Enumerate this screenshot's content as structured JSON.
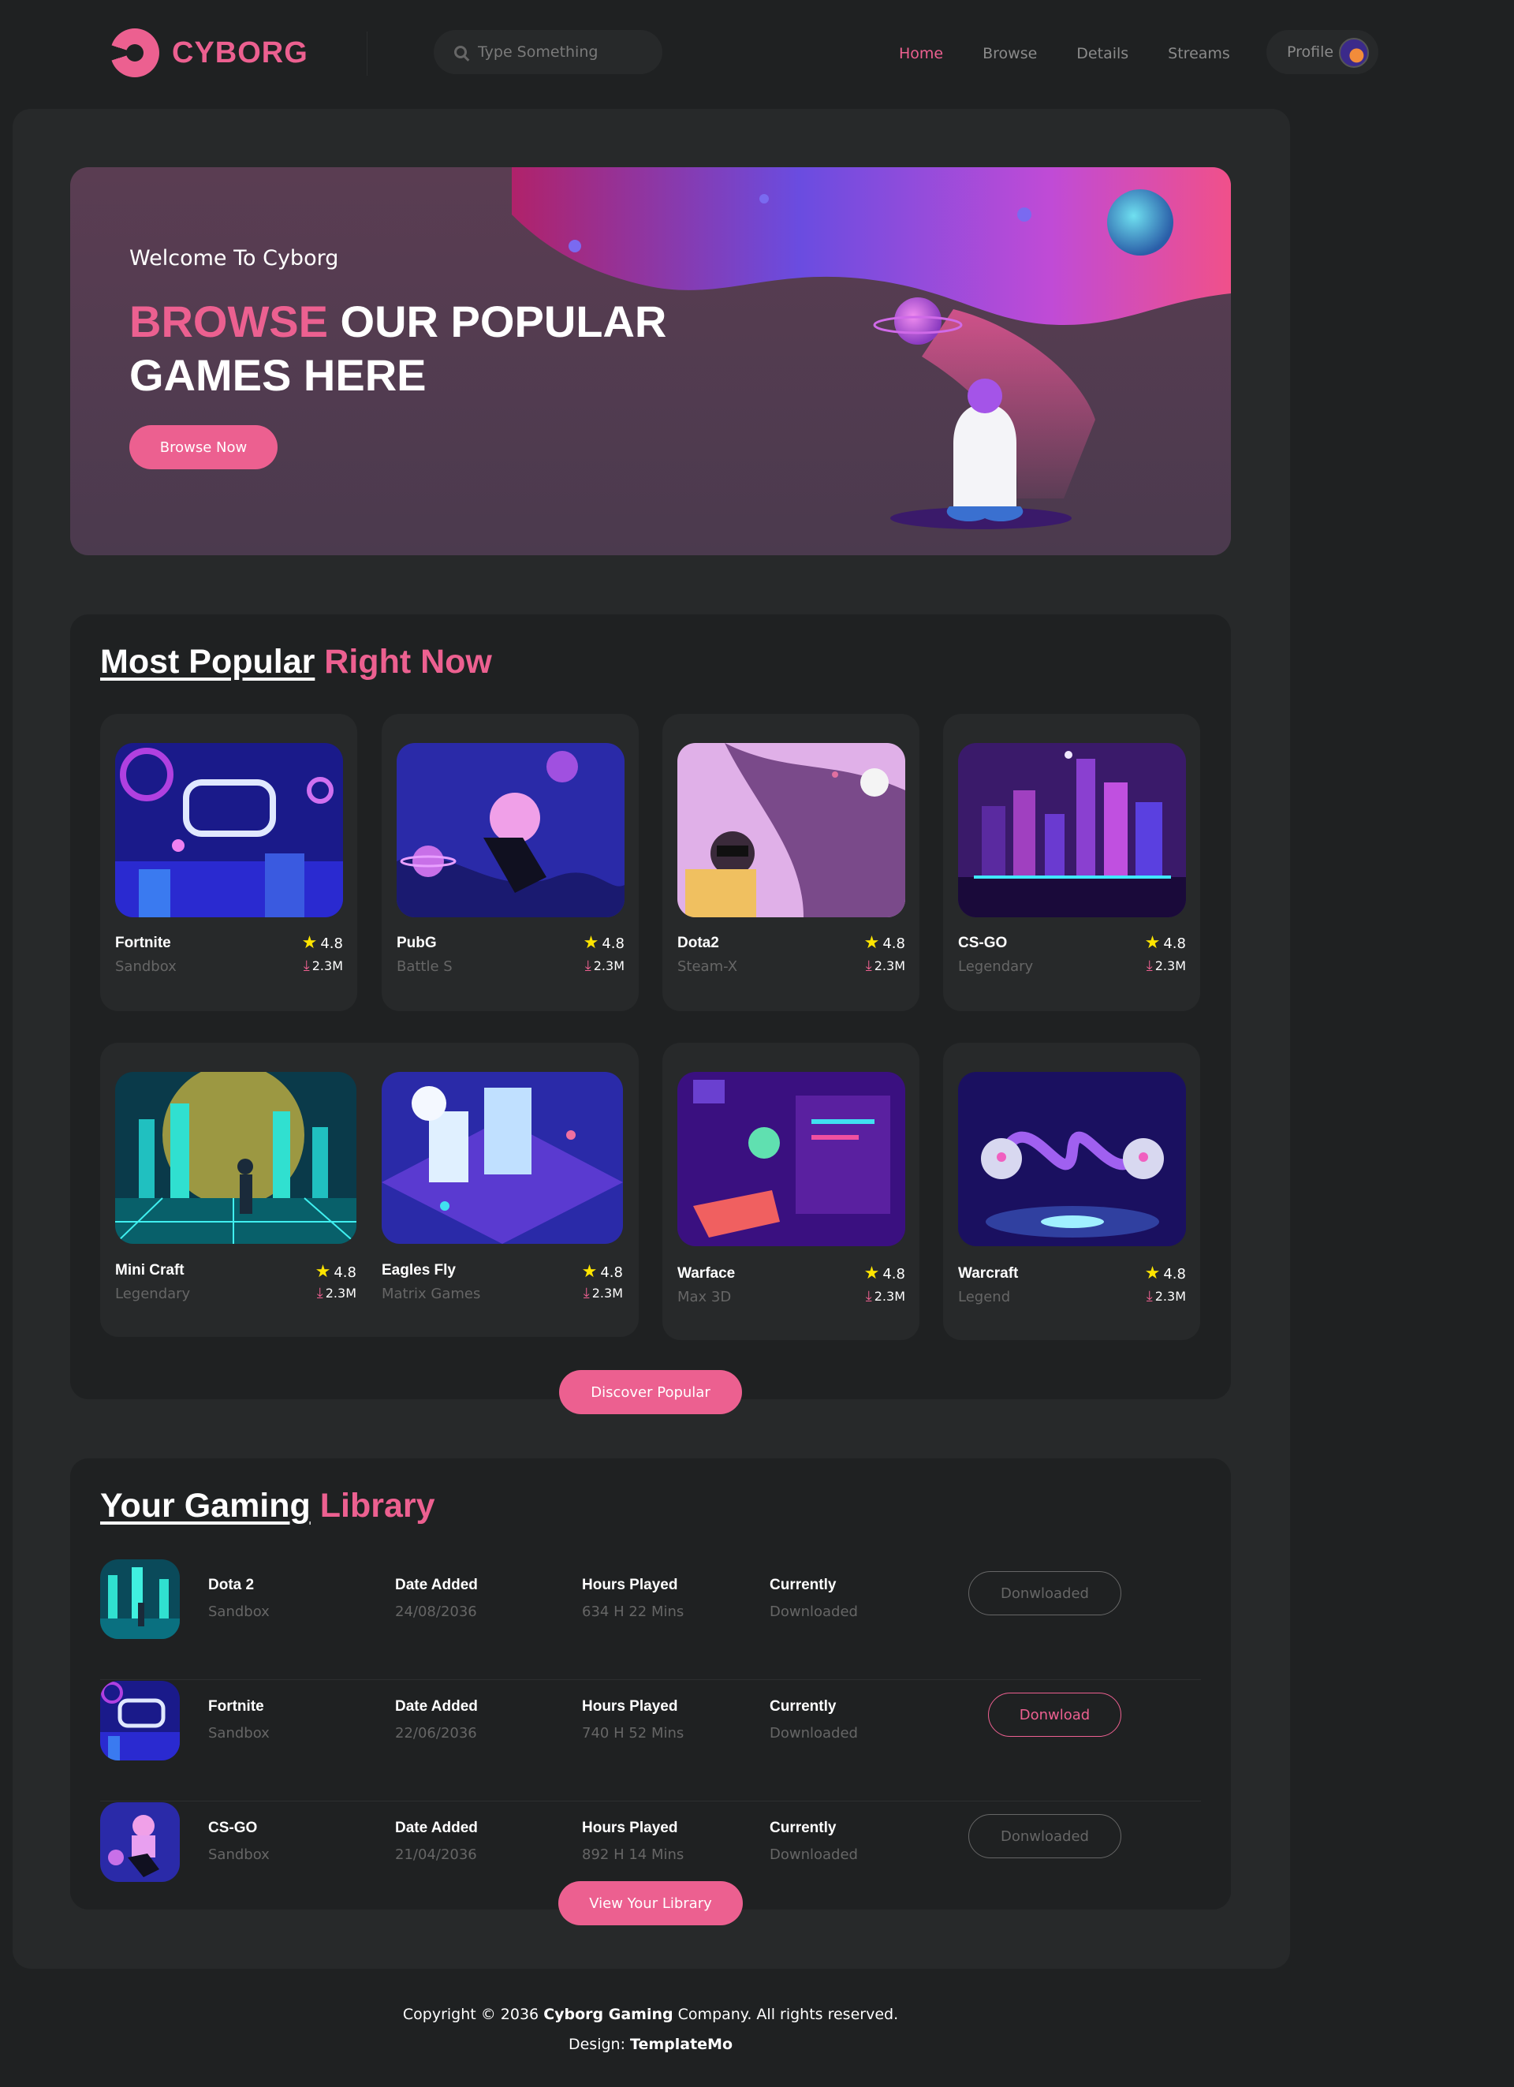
{
  "brand": {
    "name": "CYBORG"
  },
  "search": {
    "placeholder": "Type Something"
  },
  "nav": {
    "items": [
      "Home",
      "Browse",
      "Details",
      "Streams"
    ],
    "active": "Home",
    "profile_label": "Profile"
  },
  "banner": {
    "welcome": "Welcome To Cyborg",
    "headline_accent": "BROWSE",
    "headline_rest_1": " OUR POPULAR",
    "headline_rest_2": "GAMES HERE",
    "cta": "Browse Now"
  },
  "popular": {
    "title_main": "Most Popular",
    "title_accent": "Right Now",
    "cards": [
      {
        "name": "Fortnite",
        "category": "Sandbox",
        "rating": "4.8",
        "downloads": "2.3M"
      },
      {
        "name": "PubG",
        "category": "Battle S",
        "rating": "4.8",
        "downloads": "2.3M"
      },
      {
        "name": "Dota2",
        "category": "Steam-X",
        "rating": "4.8",
        "downloads": "2.3M"
      },
      {
        "name": "CS-GO",
        "category": "Legendary",
        "rating": "4.8",
        "downloads": "2.3M"
      },
      {
        "name": "Mini Craft",
        "category": "Legendary",
        "rating": "4.8",
        "downloads": "2.3M"
      },
      {
        "name": "Eagles Fly",
        "category": "Matrix Games",
        "rating": "4.8",
        "downloads": "2.3M"
      },
      {
        "name": "Warface",
        "category": "Max 3D",
        "rating": "4.8",
        "downloads": "2.3M"
      },
      {
        "name": "Warcraft",
        "category": "Legend",
        "rating": "4.8",
        "downloads": "2.3M"
      }
    ],
    "cta": "Discover Popular"
  },
  "library": {
    "title_main": "Your Gaming",
    "title_accent": "Library",
    "col_date": "Date Added",
    "col_hours": "Hours Played",
    "col_status": "Currently",
    "rows": [
      {
        "name": "Dota 2",
        "category": "Sandbox",
        "date": "24/08/2036",
        "hours": "634 H 22 Mins",
        "status": "Downloaded",
        "button": "Donwloaded"
      },
      {
        "name": "Fortnite",
        "category": "Sandbox",
        "date": "22/06/2036",
        "hours": "740 H 52 Mins",
        "status": "Downloaded",
        "button": "Donwload"
      },
      {
        "name": "CS-GO",
        "category": "Sandbox",
        "date": "21/04/2036",
        "hours": "892 H 14 Mins",
        "status": "Downloaded",
        "button": "Donwloaded"
      }
    ],
    "cta": "View Your Library"
  },
  "footer": {
    "line1_prefix": "Copyright © 2036 ",
    "line1_bold": "Cyborg Gaming",
    "line1_suffix": " Company. All rights reserved.",
    "line2_prefix": "Design: ",
    "line2_bold": "TemplateMo"
  },
  "colors": {
    "accent": "#ec6090",
    "background": "#1f2122",
    "panel": "#27292a",
    "star": "#ffe500"
  }
}
